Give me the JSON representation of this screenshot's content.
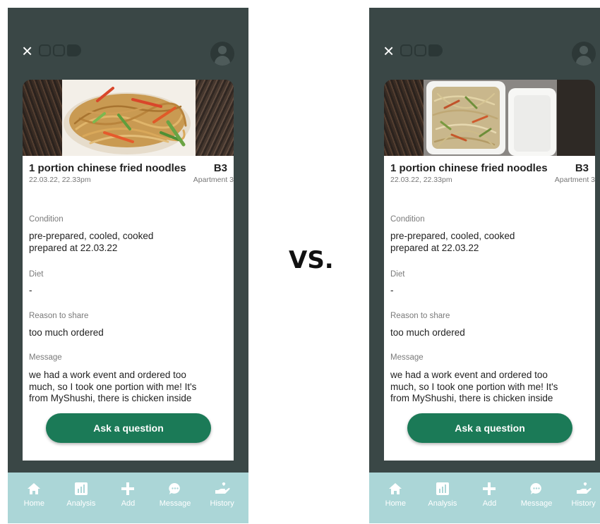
{
  "vs_text": "VS.",
  "topbar": {
    "close_icon": "close-icon",
    "close_glyph": "×",
    "avatar_icon": "avatar-icon"
  },
  "listing": {
    "title": "1 portion chinese fried noodles",
    "code": "B3",
    "datetime": "22.03.22, 22.33pm",
    "location": "Apartment 3",
    "fields": [
      {
        "label": "Condition",
        "value": "pre-prepared, cooled, cooked\nprepared at 22.03.22"
      },
      {
        "label": "Diet",
        "value": "-"
      },
      {
        "label": "Reason to share",
        "value": "too much ordered"
      },
      {
        "label": "Message",
        "value": "we had a work event and ordered too much, so I took one portion with me! It's from MyShushi, there is chicken inside"
      }
    ],
    "ask_button": "Ask a question"
  },
  "photos": {
    "left": "noodles-on-plate-photo",
    "right": "noodles-in-takeaway-box-photo"
  },
  "nav": {
    "items": [
      {
        "label": "Home",
        "icon": "home-icon"
      },
      {
        "label": "Analysis",
        "icon": "analysis-icon"
      },
      {
        "label": "Add",
        "icon": "add-icon"
      },
      {
        "label": "Message",
        "icon": "message-icon"
      },
      {
        "label": "History",
        "icon": "history-icon"
      }
    ]
  },
  "colors": {
    "background": "#3a4746",
    "accent": "#1b7a57",
    "nav_bg": "#abd6d7"
  }
}
